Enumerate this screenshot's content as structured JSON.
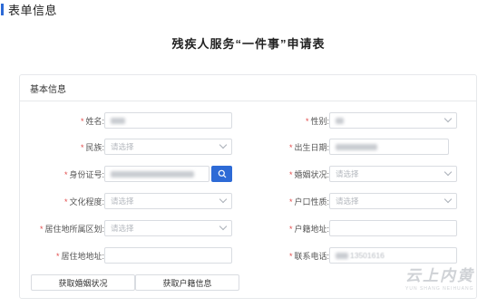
{
  "section": {
    "title": "表单信息"
  },
  "form": {
    "title": "残疾人服务“一件事”申请表"
  },
  "card": {
    "header": "基本信息"
  },
  "fields": {
    "name": {
      "label": "姓名:",
      "required": "*"
    },
    "gender": {
      "label": "性别:",
      "required": "*"
    },
    "ethnicity": {
      "label": "民族:",
      "required": "*",
      "placeholder": "请选择"
    },
    "birthdate": {
      "label": "出生日期:",
      "required": "*"
    },
    "id_number": {
      "label": "身份证号:",
      "required": "*"
    },
    "marital": {
      "label": "婚姻状况:",
      "required": "*",
      "placeholder": "请选择"
    },
    "education": {
      "label": "文化程度:",
      "required": "*",
      "placeholder": "请选择"
    },
    "hukou_type": {
      "label": "户口性质:",
      "required": "*",
      "placeholder": "请选择"
    },
    "residence_district": {
      "label": "居住地所属区划:",
      "required": "*",
      "placeholder": "请选择"
    },
    "hukou_address": {
      "label": "户籍地址:",
      "required": "*"
    },
    "residence_address": {
      "label": "居住地地址:",
      "required": "*"
    },
    "phone": {
      "label": "联系电话:",
      "required": "*",
      "value": "13501616"
    }
  },
  "buttons": {
    "get_marital": "获取婚姻状况",
    "get_hukou": "获取户籍信息"
  },
  "watermark": {
    "main": "云上内黄",
    "sub": "YUN SHANG NEIHUANG"
  },
  "colors": {
    "accent": "#2d6ad6",
    "required": "#e24b4b",
    "border": "#d9dce1"
  },
  "icons": {
    "search": "search-icon",
    "dropdown": "chevron-down-icon"
  }
}
